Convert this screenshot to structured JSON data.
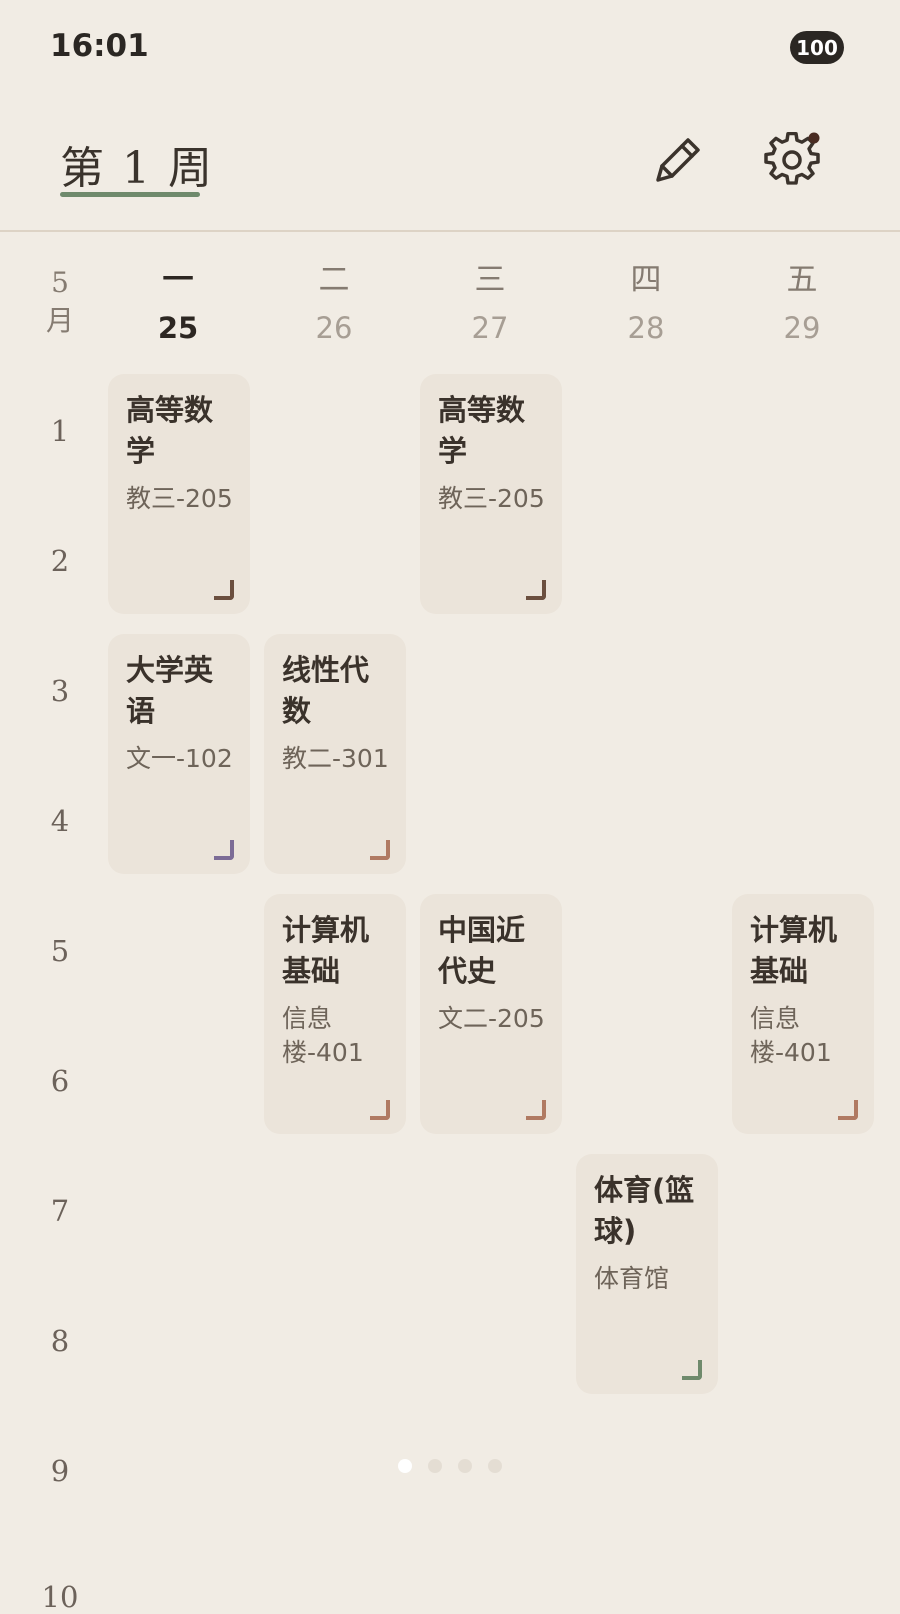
{
  "status_bar": {
    "time": "16:01",
    "battery": "100"
  },
  "header": {
    "week_title": "第 1 周",
    "edit_icon": "pencil-icon",
    "settings_icon": "gear-icon"
  },
  "month": {
    "number": "5",
    "unit": "月"
  },
  "days": [
    {
      "name": "一",
      "date": "25",
      "today": true
    },
    {
      "name": "二",
      "date": "26"
    },
    {
      "name": "三",
      "date": "27"
    },
    {
      "name": "四",
      "date": "28"
    },
    {
      "name": "五",
      "date": "29"
    }
  ],
  "periods": [
    "1",
    "2",
    "3",
    "4",
    "5",
    "6",
    "7",
    "8",
    "9",
    "10"
  ],
  "courses": [
    {
      "name": "高等数学",
      "room": "教三-205",
      "corner_color": "#6b4f3f"
    },
    {
      "name": "高等数学",
      "room": "教三-205",
      "corner_color": "#6b4f3f"
    },
    {
      "name": "大学英语",
      "room": "文一-102",
      "corner_color": "#7c6c96"
    },
    {
      "name": "线性代数",
      "room": "教二-301",
      "corner_color": "#b07a62"
    },
    {
      "name": "计算机基础",
      "room": "信息楼-401",
      "corner_color": "#b07a62"
    },
    {
      "name": "中国近代史",
      "room": "文二-205",
      "corner_color": "#b07a62"
    },
    {
      "name": "计算机基础",
      "room": "信息楼-401",
      "corner_color": "#b07a62"
    },
    {
      "name": "体育(篮球)",
      "room": "体育馆",
      "corner_color": "#6f8a6c"
    }
  ],
  "pager": {
    "total": 4,
    "current": 1
  }
}
